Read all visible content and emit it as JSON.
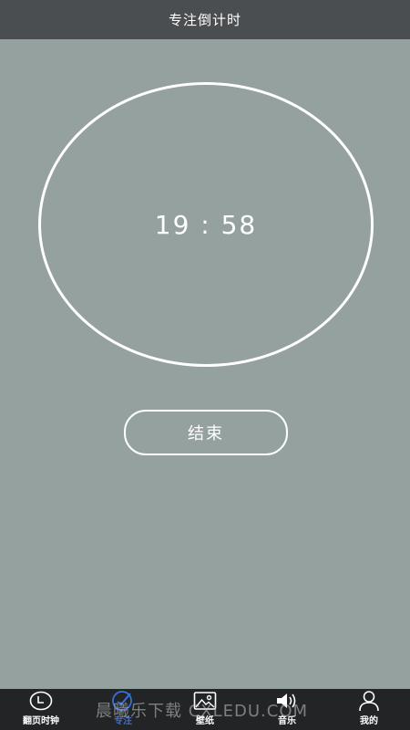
{
  "header": {
    "title": "专注倒计时"
  },
  "timer": {
    "display": "19 : 58"
  },
  "actions": {
    "end_label": "结束"
  },
  "nav": {
    "items": [
      {
        "label": "翻页时钟",
        "icon": "clock-icon"
      },
      {
        "label": "专注",
        "icon": "focus-icon"
      },
      {
        "label": "壁纸",
        "icon": "image-icon"
      },
      {
        "label": "音乐",
        "icon": "speaker-icon"
      },
      {
        "label": "我的",
        "icon": "person-icon"
      }
    ],
    "active_color": "#3a6fd8"
  },
  "watermark": {
    "text": "晨曦乐下载 CXLEDU.COM"
  },
  "colors": {
    "background": "#94a19f",
    "header": "#4a4e51",
    "nav_bar": "#222426",
    "foreground": "#ffffff"
  }
}
